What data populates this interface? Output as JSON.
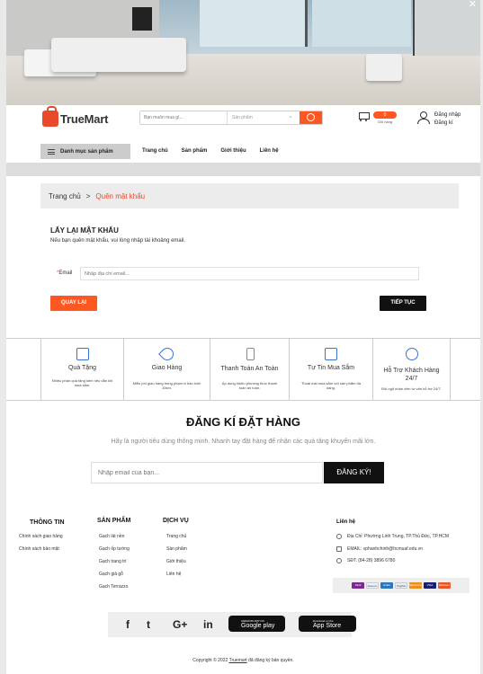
{
  "header": {
    "logo_text": "TrueMart",
    "search_placeholder": "Bạn muốn mua gì...",
    "search_category": "Sản phẩm",
    "cart_count": "0",
    "cart_label": "Giỏ hàng",
    "login": "Đăng nhập",
    "register": "Đăng kí"
  },
  "nav": {
    "category_menu": "Danh mục sản phẩm",
    "links": [
      "Trang chủ",
      "Sản phẩm",
      "Giới thiệu",
      "Liên hệ"
    ]
  },
  "breadcrumb": {
    "home": "Trang chủ",
    "separator": ">",
    "current": "Quên mật khẩu"
  },
  "form": {
    "title": "LẤY LẠI MẬT KHẨU",
    "subtitle": "Nếu bạn quên mật khẩu, vui lòng nhập tài khoảng email.",
    "email_required_mark": "*",
    "email_label": "Email",
    "email_placeholder": "Nhập địa chỉ email...",
    "back_button": "QUAY LẠI",
    "next_button": "TIẾP TỤC"
  },
  "features": [
    {
      "icon": "gift-icon",
      "name": "Quà Tặng",
      "desc": "Nhiều phần quà tặng kèm nếu dẫn khi mua sắm."
    },
    {
      "icon": "rocket-icon",
      "name": "Giao Hàng",
      "desc": "Miễn phí giao hàng trong phạm vi bán kính 10km."
    },
    {
      "icon": "lock-icon",
      "name": "Thanh Toán An Toàn",
      "desc": "Áp dụng nhiều phương thức thanh toán an toàn."
    },
    {
      "icon": "download-icon",
      "name": "Tự Tin Mua Sắm",
      "desc": "Thoải mái mua sắm với sản phẩm đa dạng."
    },
    {
      "icon": "support-icon",
      "name": "Hỗ Trợ Khách Hàng 24/7",
      "desc": "Đội ngũ nhân viên tư vấn hỗ trợ 24/7."
    }
  ],
  "subscribe": {
    "title": "ĐĂNG KÍ ĐẶT HÀNG",
    "desc": "Hãy là người tiêu dùng thông minh. Nhanh tay đặt hàng để nhận các quà tặng khuyến mãi lớn.",
    "placeholder": "Nhập email của bạn...",
    "button": "ĐĂNG KÝ!"
  },
  "footer": {
    "info_title": "THÔNG TIN",
    "info_links": [
      "Chính sách giao hàng",
      "Chính sách bảo mật"
    ],
    "products_title": "SẢN PHẨM",
    "products_links": [
      "Gạch lát nền",
      "Gạch ốp tường",
      "Gạch trang trí",
      "Gạch giả gỗ",
      "Gạch Terrazzo"
    ],
    "services_title": "DỊCH VỤ",
    "services_links": [
      "Trang chủ",
      "Sản phẩm",
      "Giới thiệu",
      "Liên hệ"
    ],
    "contact_title": "Liên hệ",
    "address": "Địa Chỉ: Phường Linh Trung, TP.Thủ Đức, TP.HCM",
    "email": "EMAIL: vphanhchinh@hcmuaf.edu.vn",
    "phone": "SĐT: (84-28) 3896 6780",
    "payments": [
      "Skrill",
      "Maestro",
      "AmEx",
      "PayPal",
      "MasterCard",
      "VISA",
      "Discover"
    ],
    "social": [
      "f",
      "t",
      "G+",
      "in"
    ],
    "google_play_small": "ANDROID APP ON",
    "google_play": "Google play",
    "app_store_small": "Download on the",
    "app_store": "App Store",
    "copyright_prefix": "Copyright © 2022 ",
    "copyright_brand": "Truemart",
    "copyright_suffix": " đã đăng ký bản quyền."
  },
  "colors": {
    "accent": "#ff5722",
    "feature_icon": "#3b6fd8",
    "dark_button": "#111111"
  }
}
